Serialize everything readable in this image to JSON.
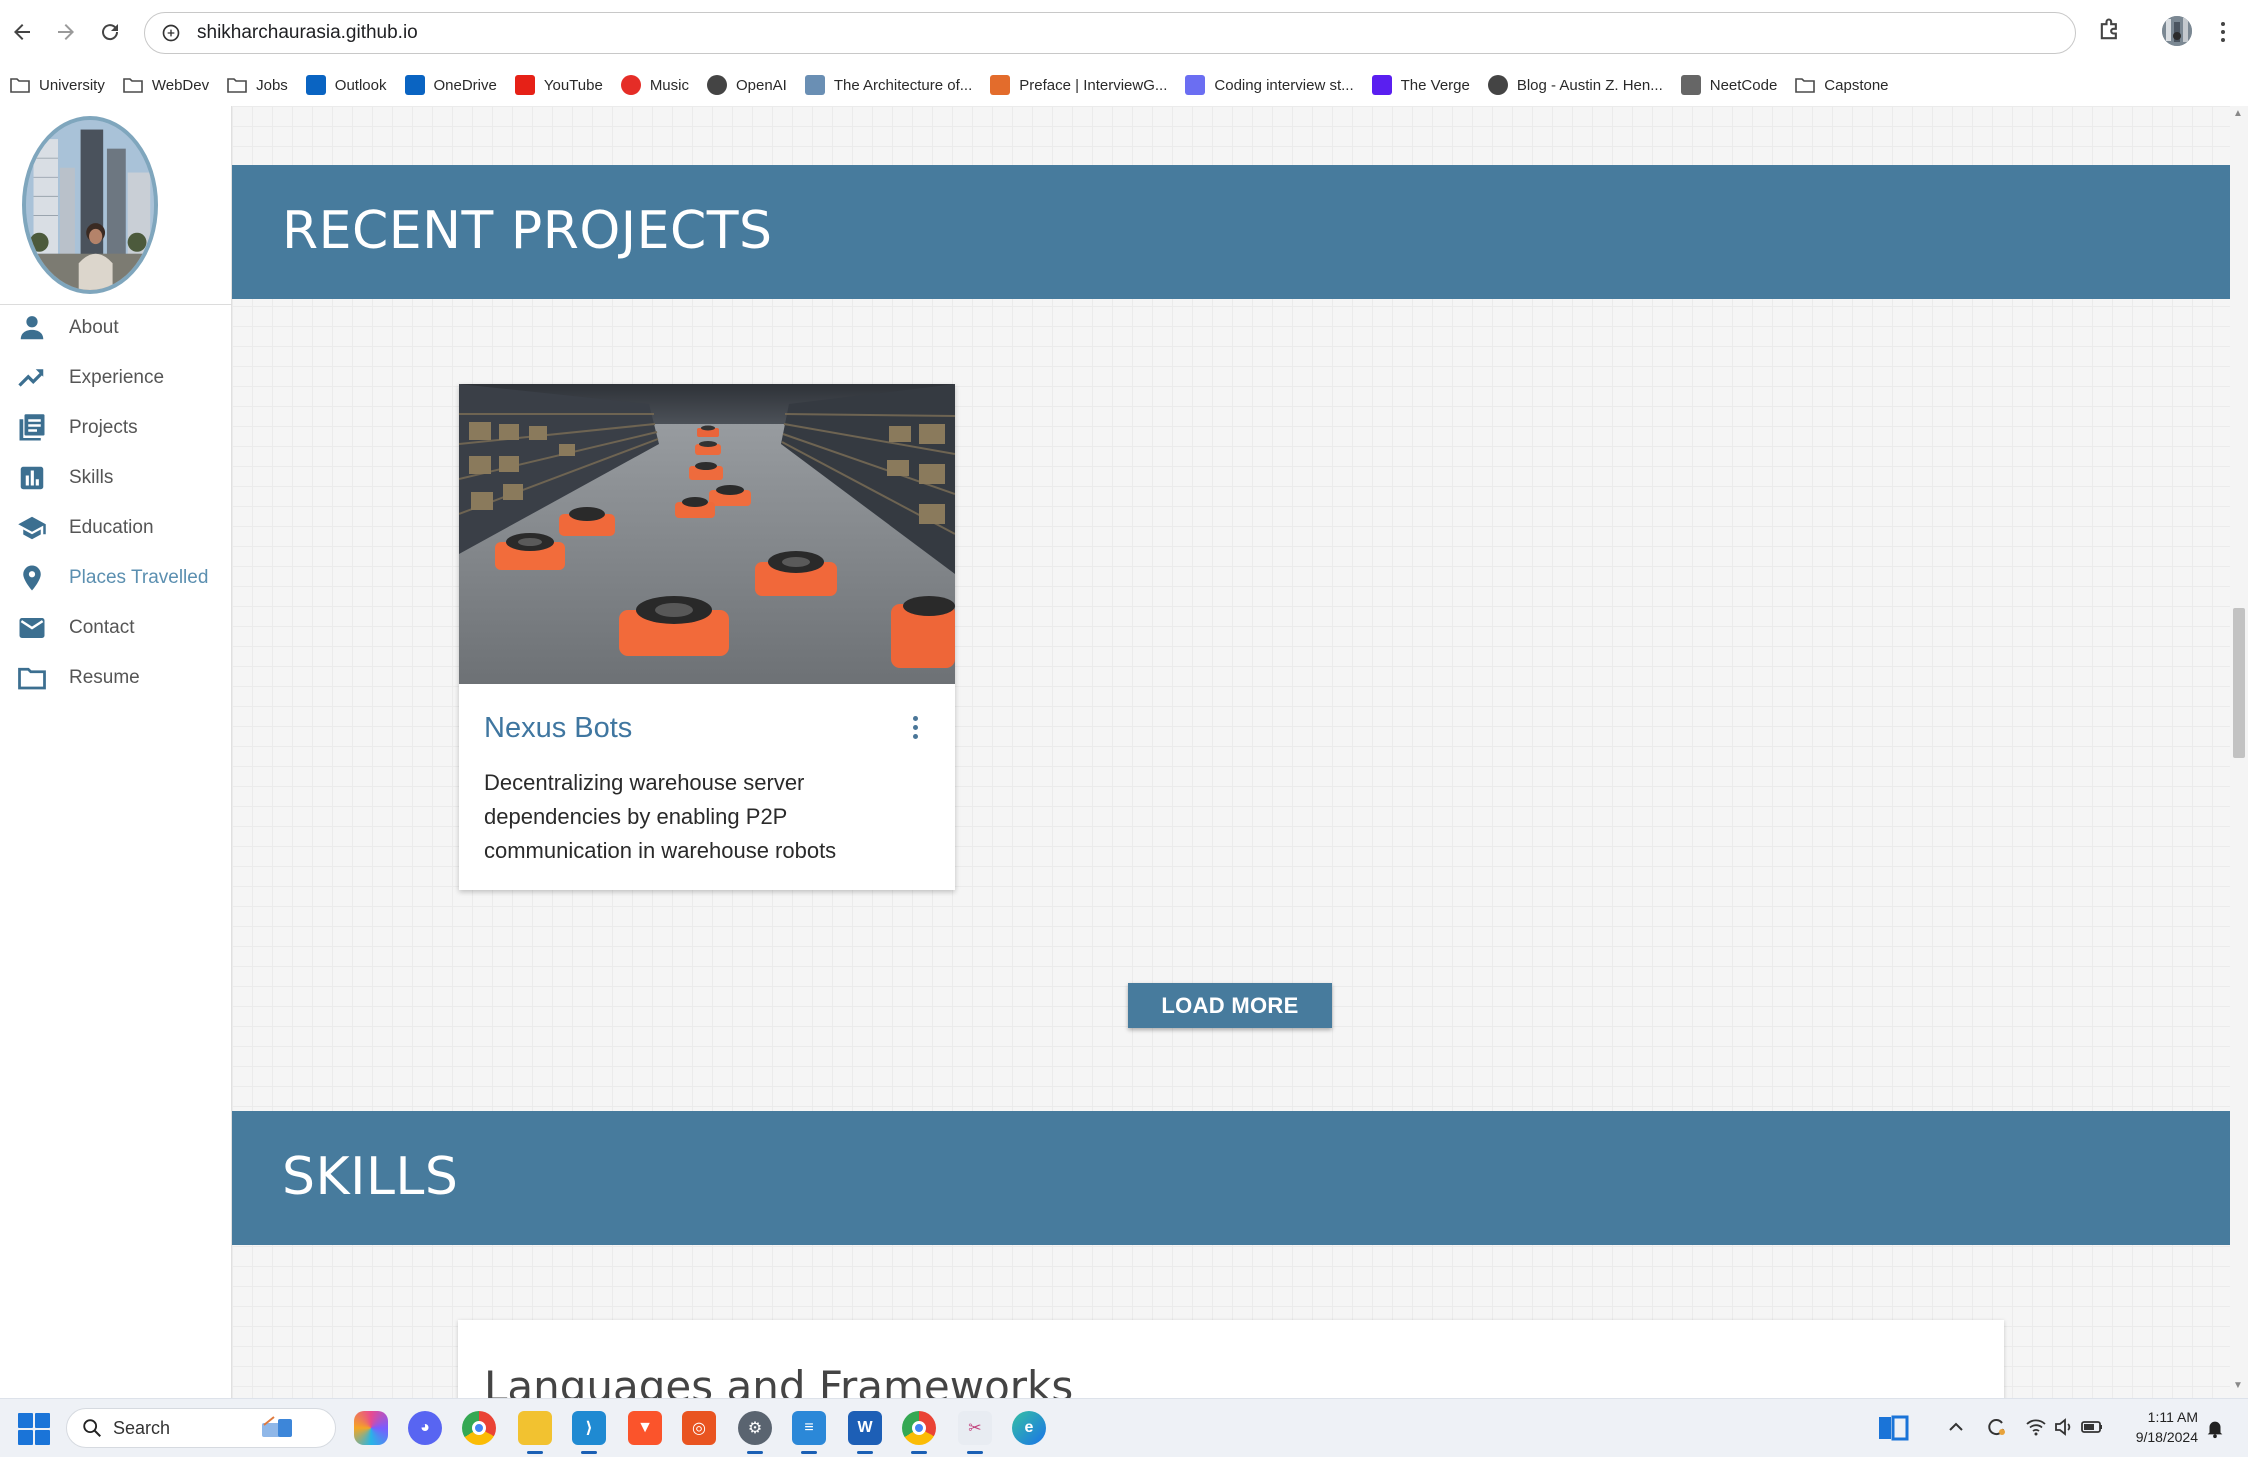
{
  "browser": {
    "url": "shikharchaurasia.github.io",
    "bookmarks": [
      {
        "label": "University",
        "icon": "folder-icon",
        "color": "#5f6368"
      },
      {
        "label": "WebDev",
        "icon": "folder-icon",
        "color": "#5f6368"
      },
      {
        "label": "Jobs",
        "icon": "folder-icon",
        "color": "#5f6368"
      },
      {
        "label": "Outlook",
        "icon": "outlook-icon",
        "color": "#0a64c2"
      },
      {
        "label": "OneDrive",
        "icon": "onedrive-icon",
        "color": "#0a64c2"
      },
      {
        "label": "YouTube",
        "icon": "youtube-icon",
        "color": "#e62117"
      },
      {
        "label": "Music",
        "icon": "music-icon",
        "color": "#e52d27"
      },
      {
        "label": "OpenAI",
        "icon": "openai-icon",
        "color": "#444444"
      },
      {
        "label": "The Architecture of...",
        "icon": "architecture-icon",
        "color": "#6a8fb4"
      },
      {
        "label": "Preface | InterviewG...",
        "icon": "interview-icon",
        "color": "#e36c2c"
      },
      {
        "label": "Coding interview st...",
        "icon": "code-icon",
        "color": "#6b6ef2"
      },
      {
        "label": "The Verge",
        "icon": "verge-icon",
        "color": "#5a1ff0"
      },
      {
        "label": "Blog - Austin Z. Hen...",
        "icon": "globe-icon",
        "color": "#444444"
      },
      {
        "label": "NeetCode",
        "icon": "rocket-icon",
        "color": "#666666"
      },
      {
        "label": "Capstone",
        "icon": "folder-icon",
        "color": "#5f6368"
      }
    ]
  },
  "sidebar": {
    "items": [
      {
        "label": "About",
        "icon": "person-icon",
        "active": false
      },
      {
        "label": "Experience",
        "icon": "trending-up-icon",
        "active": false
      },
      {
        "label": "Projects",
        "icon": "library-icon",
        "active": false
      },
      {
        "label": "Skills",
        "icon": "bar-chart-icon",
        "active": false
      },
      {
        "label": "Education",
        "icon": "school-icon",
        "active": false
      },
      {
        "label": "Places Travelled",
        "icon": "location-pin-icon",
        "active": true
      },
      {
        "label": "Contact",
        "icon": "mail-icon",
        "active": false
      },
      {
        "label": "Resume",
        "icon": "folder-icon",
        "active": false
      }
    ]
  },
  "projects_section": {
    "title": "RECENT PROJECTS",
    "card": {
      "title": "Nexus Bots",
      "description": "Decentralizing warehouse server dependencies by enabling P2P communication in warehouse robots",
      "image": "warehouse-robots-image"
    },
    "load_more_label": "LOAD MORE"
  },
  "skills_section": {
    "title": "SKILLS",
    "card_title": "Languages and Frameworks"
  },
  "taskbar": {
    "search_label": "Search",
    "time": "1:11 AM",
    "date": "9/18/2024"
  },
  "colors": {
    "accent": "#477b9d",
    "link": "#3f76a0"
  }
}
